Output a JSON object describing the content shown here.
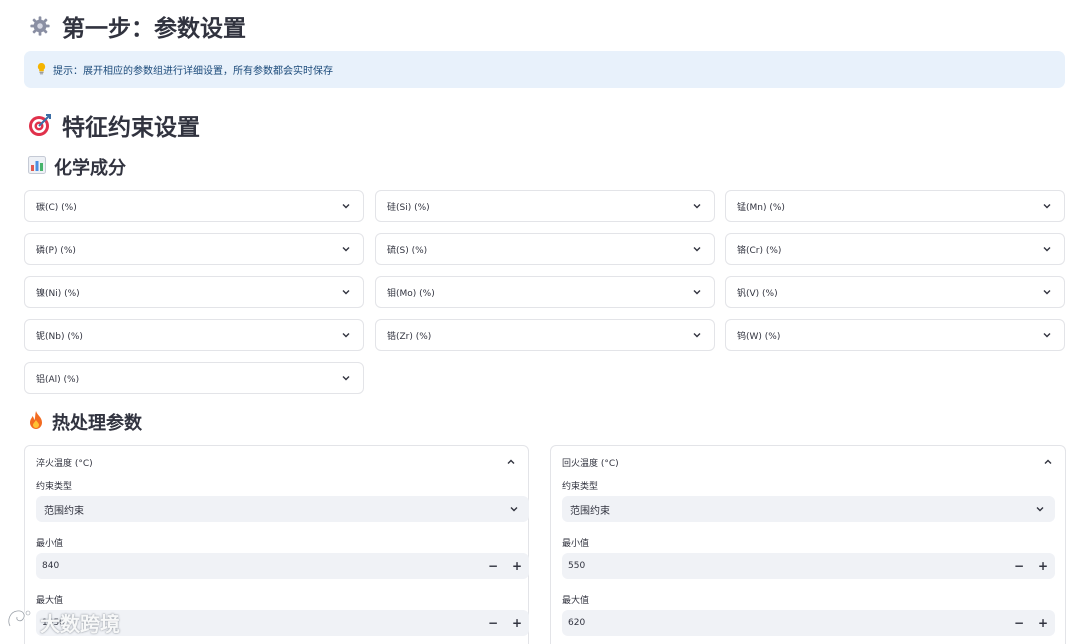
{
  "header": {
    "title": "第一步：参数设置",
    "icon": "gear-icon"
  },
  "hint": {
    "icon": "lightbulb-icon",
    "text": "提示：展开相应的参数组进行详细设置，所有参数都会实时保存"
  },
  "section": {
    "title": "特征约束设置",
    "icon": "target-icon"
  },
  "chemistry": {
    "title": "化学成分",
    "icon": "bar-chart-icon",
    "items": [
      {
        "label": "碳(C) (%)"
      },
      {
        "label": "硅(Si) (%)"
      },
      {
        "label": "锰(Mn) (%)"
      },
      {
        "label": "磷(P) (%)"
      },
      {
        "label": "硫(S) (%)"
      },
      {
        "label": "铬(Cr) (%)"
      },
      {
        "label": "镍(Ni) (%)"
      },
      {
        "label": "钼(Mo) (%)"
      },
      {
        "label": "钒(V) (%)"
      },
      {
        "label": "铌(Nb) (%)"
      },
      {
        "label": "锆(Zr) (%)"
      },
      {
        "label": "钨(W) (%)"
      },
      {
        "label": "铝(Al) (%)"
      }
    ]
  },
  "heat": {
    "title": "热处理参数",
    "icon": "fire-icon",
    "panels": [
      {
        "title": "淬火温度 (°C)",
        "type_label": "约束类型",
        "type_value": "范围约束",
        "min_label": "最小值",
        "min_value": "840",
        "max_label": "最大值",
        "max_value": "1050"
      },
      {
        "title": "回火温度 (°C)",
        "type_label": "约束类型",
        "type_value": "范围约束",
        "min_label": "最小值",
        "min_value": "550",
        "max_label": "最大值",
        "max_value": "620"
      }
    ]
  },
  "steppers": {
    "minus": "−",
    "plus": "+"
  },
  "watermark": {
    "text": "大数跨境"
  },
  "colors": {
    "hint_bg": "#e8f1fb",
    "hint_text": "#1b4a7a",
    "input_bg": "#f0f2f6",
    "border": "#e3e4e8"
  }
}
